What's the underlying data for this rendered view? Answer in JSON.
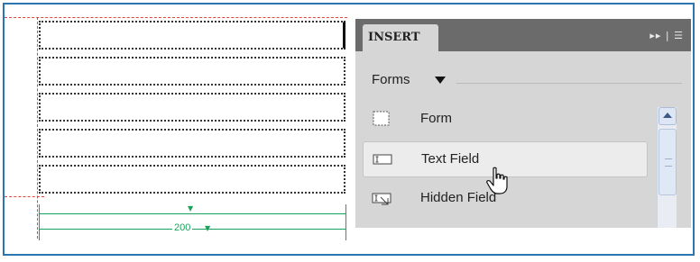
{
  "canvas": {
    "measurement_label": "200"
  },
  "panel": {
    "tab_title": "INSERT",
    "header_icons": "▸▸ | ☰",
    "category": {
      "label": "Forms"
    },
    "items": [
      {
        "label": "Form",
        "icon": "form-icon"
      },
      {
        "label": "Text Field",
        "icon": "text-field-icon",
        "hover": true
      },
      {
        "label": "Hidden Field",
        "icon": "hidden-field-icon"
      }
    ]
  },
  "colors": {
    "frame": "#2b76b0",
    "guide": "#e0443c",
    "measure": "#19a25a",
    "panel_header": "#6b6b6b",
    "panel_bg": "#d6d6d6"
  }
}
